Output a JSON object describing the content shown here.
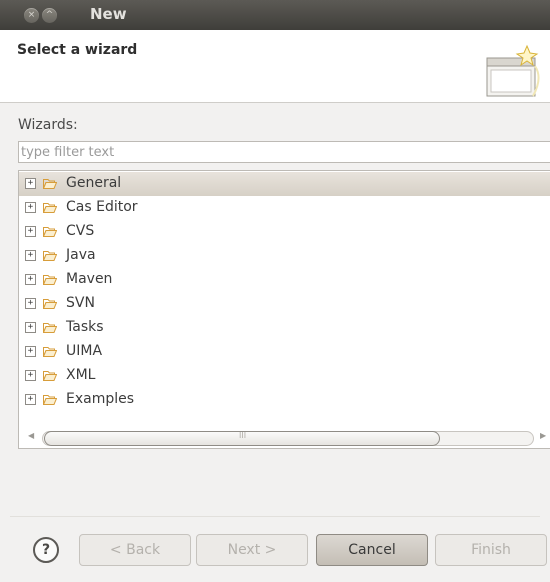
{
  "window": {
    "title": "New",
    "close_glyph": "×",
    "min_glyph": "^"
  },
  "header": {
    "title": "Select a wizard",
    "icon": "new-wizard-icon"
  },
  "wizards": {
    "label": "Wizards:",
    "filter_placeholder": "type filter text",
    "filter_value": "",
    "items": [
      {
        "expander": "+",
        "label": "General",
        "icon": "folder-icon",
        "selected": true
      },
      {
        "expander": "+",
        "label": "Cas Editor",
        "icon": "folder-icon",
        "selected": false
      },
      {
        "expander": "+",
        "label": "CVS",
        "icon": "folder-icon",
        "selected": false
      },
      {
        "expander": "+",
        "label": "Java",
        "icon": "folder-icon",
        "selected": false
      },
      {
        "expander": "+",
        "label": "Maven",
        "icon": "folder-icon",
        "selected": false
      },
      {
        "expander": "+",
        "label": "SVN",
        "icon": "folder-icon",
        "selected": false
      },
      {
        "expander": "+",
        "label": "Tasks",
        "icon": "folder-icon",
        "selected": false
      },
      {
        "expander": "+",
        "label": "UIMA",
        "icon": "folder-icon",
        "selected": false
      },
      {
        "expander": "+",
        "label": "XML",
        "icon": "folder-icon",
        "selected": false
      },
      {
        "expander": "+",
        "label": "Examples",
        "icon": "folder-icon",
        "selected": false
      }
    ],
    "scrollbar": {
      "left_arrow": "◀",
      "right_arrow": "▶",
      "grip": "III"
    }
  },
  "footer": {
    "help_glyph": "?",
    "back_label": "< Back",
    "next_label": "Next >",
    "cancel_label": "Cancel",
    "finish_label": "Finish"
  },
  "colors": {
    "selection": "#d6d0c6",
    "titlebar": "#3f3e3a",
    "folder": "#d79d3a"
  }
}
